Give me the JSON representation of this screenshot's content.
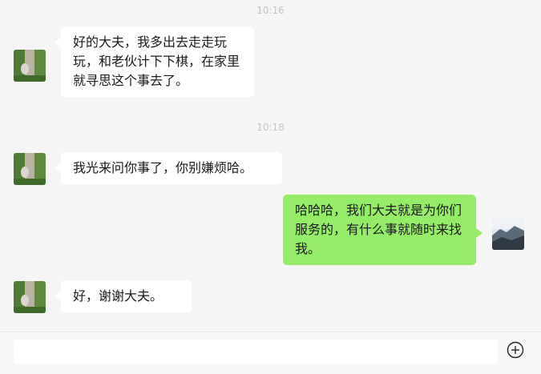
{
  "conversation": {
    "timestamps": [
      "10:16",
      "10:18"
    ],
    "messages": [
      {
        "side": "left",
        "text": "好的大夫，我多出去走走玩玩，和老伙计下下棋，在家里就寻思这个事去了。"
      },
      {
        "side": "left",
        "text": "我光来问你事了，你别嫌烦哈。"
      },
      {
        "side": "right",
        "text": "哈哈哈，我们大夫就是为你们服务的，有什么事就随时来找我。"
      },
      {
        "side": "left",
        "text": "好，谢谢大夫。"
      }
    ]
  },
  "composer": {
    "input_value": "",
    "add_icon": "plus-circle-icon"
  },
  "colors": {
    "background": "#f5f5f5",
    "incoming_bubble": "#ffffff",
    "outgoing_bubble": "#95ec69",
    "timestamp_text": "#c4c4c4"
  }
}
